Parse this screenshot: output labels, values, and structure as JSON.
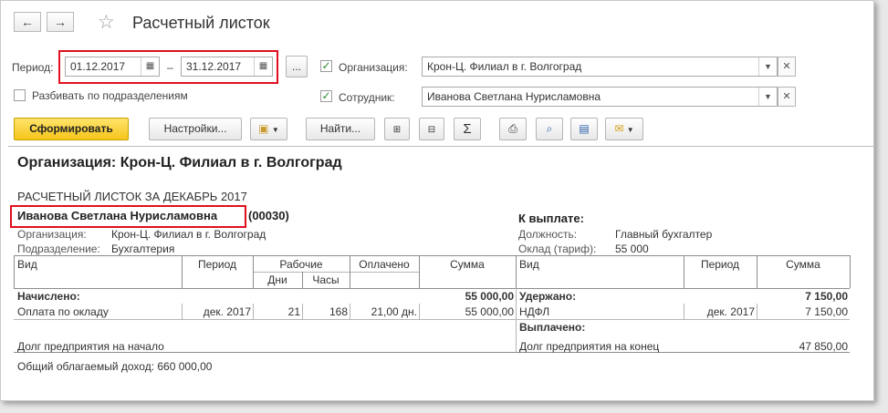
{
  "window": {
    "title": "Расчетный листок",
    "nav": {
      "back_icon": "←",
      "forward_icon": "→",
      "favorite_icon": "☆"
    }
  },
  "filters": {
    "period_label": "Период:",
    "date_from": "01.12.2017",
    "dash": "–",
    "date_to": "31.12.2017",
    "ellipsis": "...",
    "split_label": "Разбивать по подразделениям",
    "organization_label": "Организация:",
    "organization_value": "Крон-Ц. Филиал в г. Волгоград",
    "employee_label": "Сотрудник:",
    "employee_value": "Иванова Светлана Нурисламовна"
  },
  "toolbar": {
    "generate_label": "Сформировать",
    "settings_label": "Настройки...",
    "find_label": "Найти...",
    "sum_icon": "Σ"
  },
  "report": {
    "org_title": "Организация: Крон-Ц. Филиал в г. Волгоград",
    "subtitle": "РАСЧЕТНЫЙ ЛИСТОК ЗА ДЕКАБРЬ 2017",
    "employee_name": "Иванова Светлана Нурисламовна",
    "employee_code": "(00030)",
    "org_key": "Организация:",
    "org_val": "Крон-Ц. Филиал в г. Волгоград",
    "dept_key": "Подразделение:",
    "dept_val": "Бухгалтерия",
    "to_pay_label": "К выплате:",
    "position_key": "Должность:",
    "position_val": "Главный бухгалтер",
    "salary_key": "Оклад (тариф):",
    "salary_val": "55 000",
    "left_table": {
      "headers": {
        "kind": "Вид",
        "period": "Период",
        "worked": "Рабочие",
        "days": "Дни",
        "hours": "Часы",
        "paid": "Оплачено",
        "sum": "Сумма"
      },
      "accrued_label": "Начислено:",
      "accrued_total": "55 000,00",
      "rows": [
        {
          "kind": "Оплата по окладу",
          "period": "дек. 2017",
          "days": "21",
          "hours": "168",
          "paid": "21,00 дн.",
          "sum": "55 000,00"
        }
      ],
      "debt_start_label": "Долг предприятия на начало"
    },
    "right_table": {
      "headers": {
        "kind": "Вид",
        "period": "Период",
        "sum": "Сумма"
      },
      "withheld_label": "Удержано:",
      "withheld_total": "7 150,00",
      "rows": [
        {
          "kind": "НДФЛ",
          "period": "дек. 2017",
          "sum": "7 150,00"
        }
      ],
      "paid_out_label": "Выплачено:",
      "debt_end_label": "Долг предприятия на конец",
      "debt_end_value": "47 850,00"
    },
    "taxable_income": "Общий облагаемый доход: 660 000,00"
  }
}
